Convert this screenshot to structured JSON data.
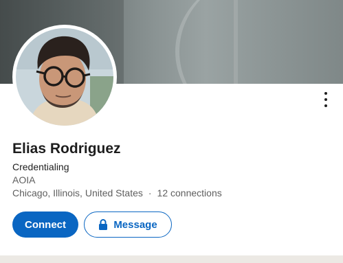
{
  "profile": {
    "name": "Elias Rodriguez",
    "headline": "Credentialing",
    "company": "AOIA",
    "location": "Chicago, Illinois, United States",
    "separator": "·",
    "connections": "12 connections",
    "avatar_description": "profile photo"
  },
  "actions": {
    "connect_label": "Connect",
    "message_label": "Message",
    "more_icon": "more-vertical-icon",
    "message_icon": "lock-icon"
  },
  "colors": {
    "accent": "#0a66c2",
    "text_primary": "#1d1d1d",
    "text_secondary": "#5e5e5e"
  }
}
